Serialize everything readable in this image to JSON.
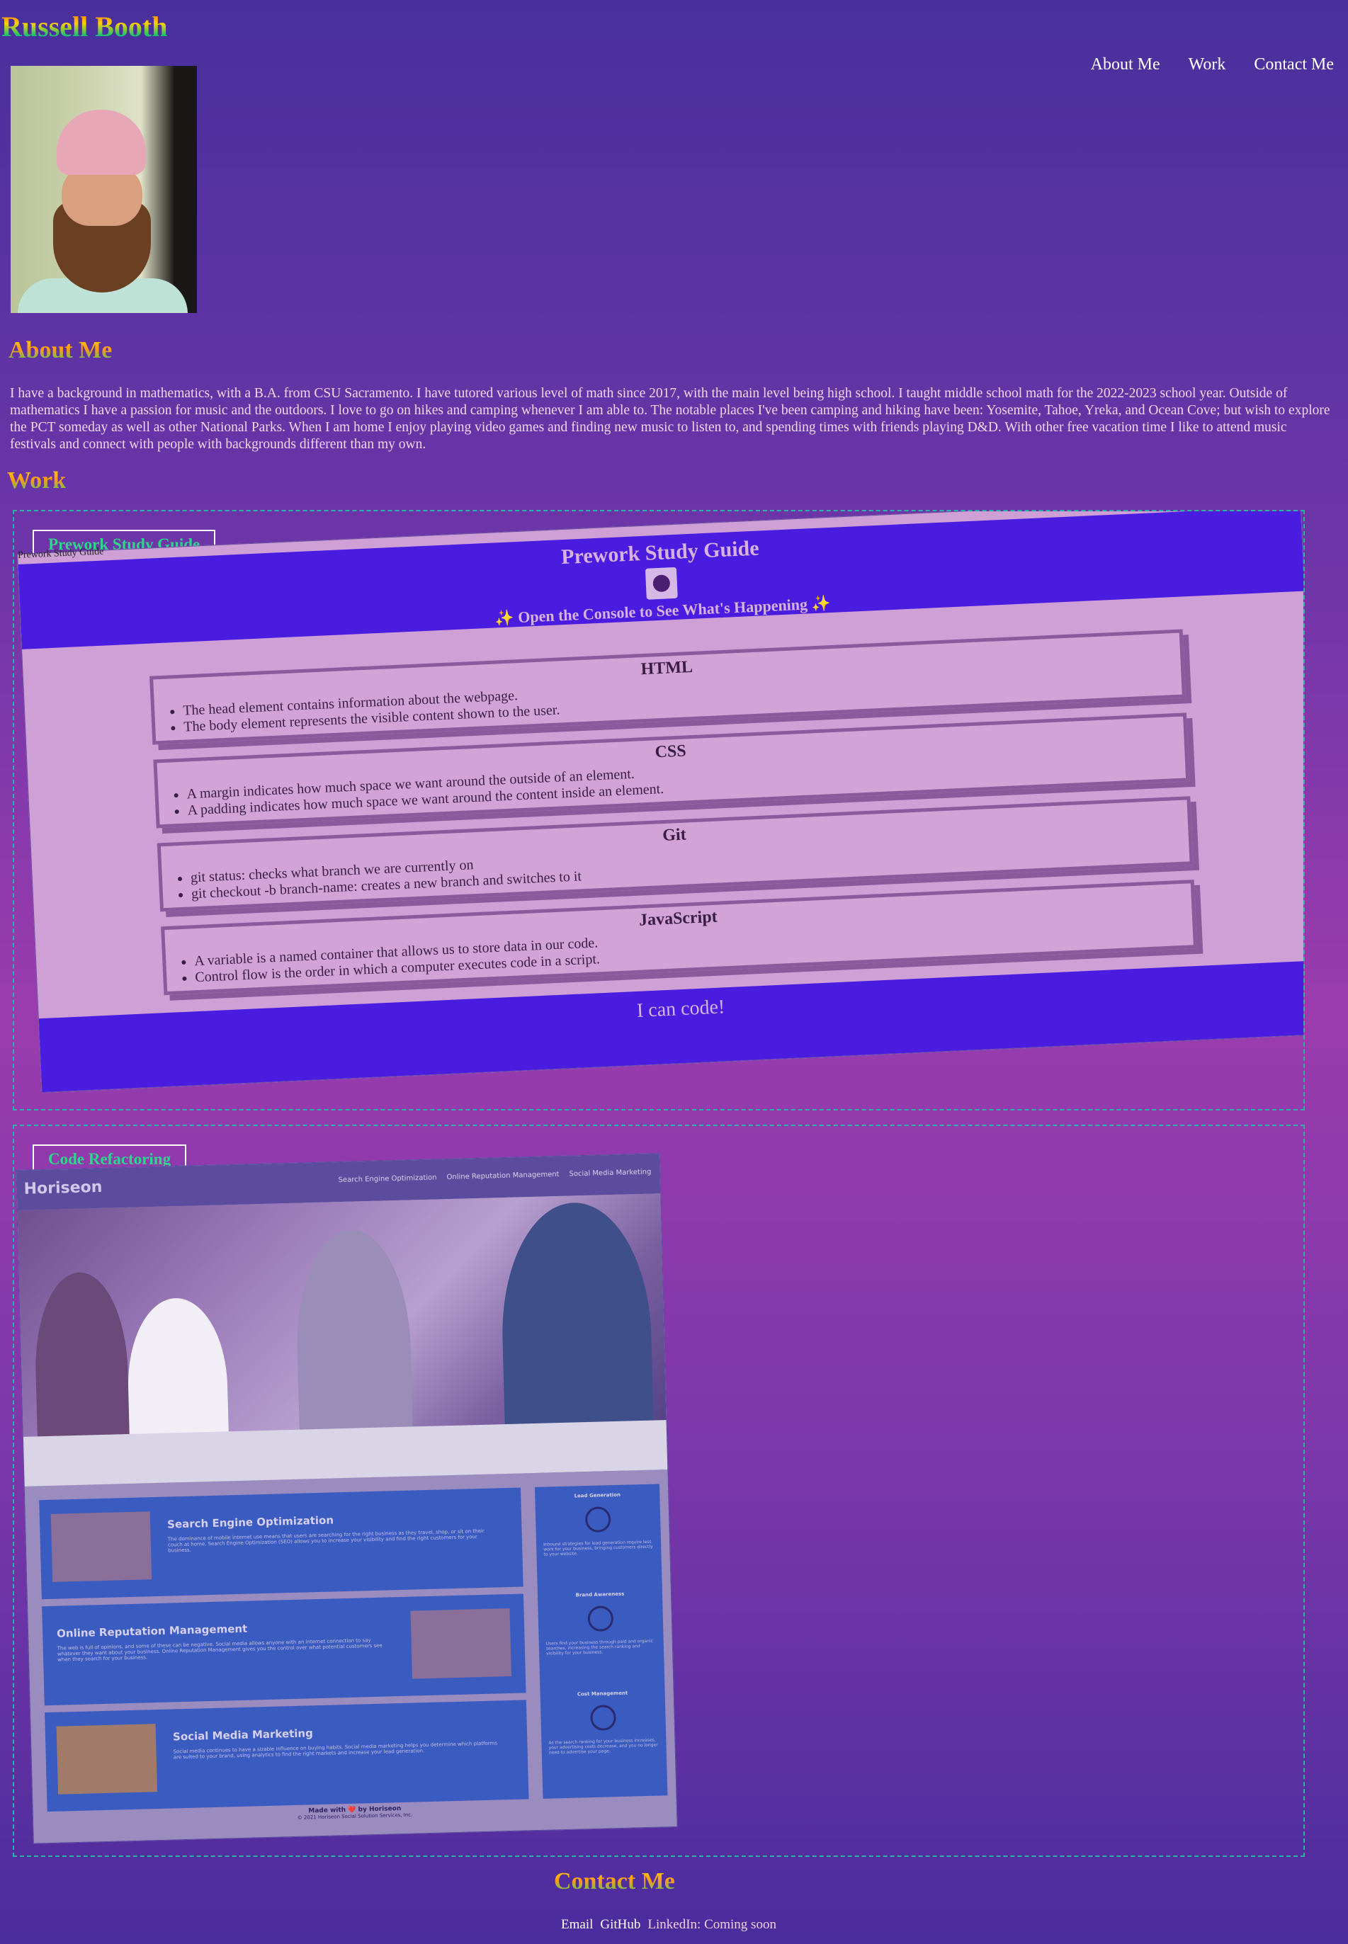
{
  "header": {
    "site_title": "Russell Booth",
    "nav": [
      "About Me",
      "Work",
      "Contact Me"
    ]
  },
  "about": {
    "heading": "About Me",
    "text": "I have a background in mathematics, with a B.A. from CSU Sacramento. I have tutored various level of math since 2017, with the main level being high school. I taught middle school math for the 2022-2023 school year. Outside of mathematics I have a passion for music and the outdoors. I love to go on hikes and camping whenever I am able to. The notable places I've been camping and hiking have been: Yosemite, Tahoe, Yreka, and Ocean Cove; but wish to explore the PCT someday as well as other National Parks. When I am home I enjoy playing video games and finding new music to listen to, and spending times with friends playing D&D. With other free vacation time I like to attend music festivals and connect with people with backgrounds different than my own."
  },
  "work": {
    "heading": "Work",
    "projects": [
      {
        "label": "Prework Study Guide",
        "screenshot": {
          "tab_label": "Prework Study Guide",
          "title": "Prework Study Guide",
          "console_note": "✨ Open the Console to See What's Happening ✨",
          "cards": [
            {
              "title": "HTML",
              "items": [
                "The head element contains information about the webpage.",
                "The body element represents the visible content shown to the user."
              ]
            },
            {
              "title": "CSS",
              "items": [
                "A margin indicates how much space we want around the outside of an element.",
                "A padding indicates how much space we want around the content inside an element."
              ]
            },
            {
              "title": "Git",
              "items": [
                "git status: checks what branch we are currently on",
                "git checkout -b branch-name: creates a new branch and switches to it"
              ]
            },
            {
              "title": "JavaScript",
              "items": [
                "A variable is a named container that allows us to store data in our code.",
                "Control flow is the order in which a computer executes code in a script."
              ]
            }
          ],
          "footer": "I can code!"
        }
      },
      {
        "label": "Code Refactoring",
        "screenshot": {
          "brand": "Horiseon",
          "nav": [
            "Search Engine Optimization",
            "Online Reputation Management",
            "Social Media Marketing"
          ],
          "services": [
            {
              "title": "Search Engine Optimization",
              "text": "The dominance of mobile internet use means that users are searching for the right business as they travel, shop, or sit on their couch at home. Search Engine Optimization (SEO) allows you to increase your visibility and find the right customers for your business."
            },
            {
              "title": "Online Reputation Management",
              "text": "The web is full of opinions, and some of these can be negative. Social media allows anyone with an internet connection to say whatever they want about your business. Online Reputation Management gives you the control over what potential customers see when they search for your business."
            },
            {
              "title": "Social Media Marketing",
              "text": "Social media continues to have a sizable influence on buying habits. Social media marketing helps you determine which platforms are suited to your brand, using analytics to find the right markets and increase your lead generation."
            }
          ],
          "benefits": [
            {
              "title": "Lead Generation",
              "text": "Inbound strategies for lead generation require less work for your business, bringing customers directly to your website."
            },
            {
              "title": "Brand Awareness",
              "text": "Users find your business through paid and organic searches, increasing the search ranking and visibility for your business."
            },
            {
              "title": "Cost Management",
              "text": "As the search ranking for your business increases, your advertising costs decrease, and you no longer need to advertise your page."
            }
          ],
          "footer_line1": "Made with ❤️ by Horiseon",
          "footer_line2": "© 2021 Horiseon Social Solution Services, Inc."
        }
      }
    ]
  },
  "contact": {
    "heading": "Contact Me",
    "email": "Email",
    "github": "GitHub",
    "linkedin": "LinkedIn: Coming soon"
  },
  "colors": {
    "heading_gradient": [
      "#ffd400",
      "#ff9a1a",
      "#2fcf6d"
    ],
    "work_label": "#2fd58a",
    "dashed_border": "#2bb3a8",
    "prework_banner": "#4a1ce0",
    "horiseon_panel": "#3a5cc0"
  }
}
